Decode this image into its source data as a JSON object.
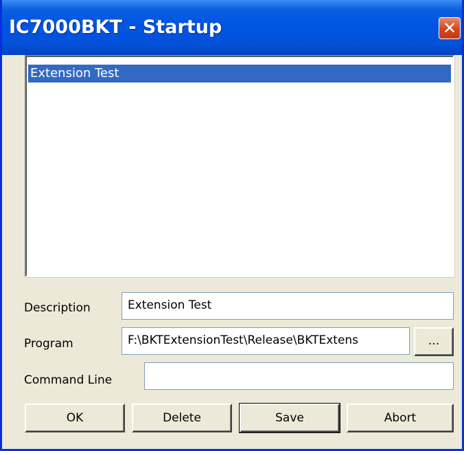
{
  "window": {
    "title": "IC7000BKT - Startup",
    "close_glyph": "✕"
  },
  "list": {
    "items": [
      {
        "label": "Extension Test",
        "selected": true
      }
    ]
  },
  "form": {
    "description": {
      "label": "Description",
      "value": "Extension Test"
    },
    "program": {
      "label": "Program",
      "value": "F:\\BKTExtensionTest\\Release\\BKTExtens",
      "browse_label": "..."
    },
    "command_line": {
      "label": "Command Line",
      "value": ""
    }
  },
  "buttons": {
    "ok": "OK",
    "delete": "Delete",
    "save": "Save",
    "abort": "Abort"
  },
  "colors": {
    "title_blue": "#0054e3",
    "selection": "#316ac5",
    "dialog_bg": "#ece9d8",
    "close_red": "#d3461e"
  }
}
